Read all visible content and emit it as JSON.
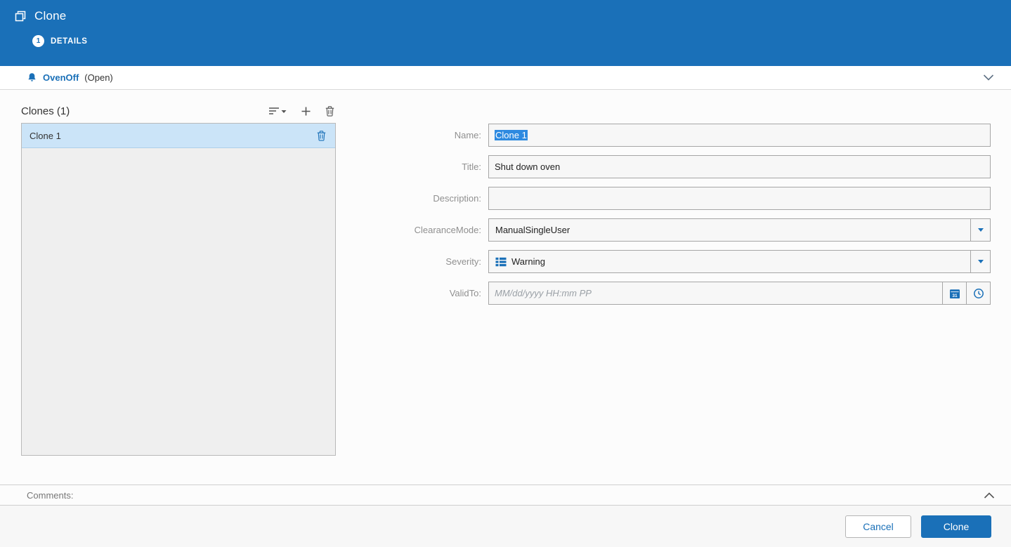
{
  "colors": {
    "accent": "#1a70b8",
    "selection": "#2e8ae0"
  },
  "header": {
    "title": "Clone",
    "step_number": "1",
    "step_label": "DETAILS"
  },
  "alarm_bar": {
    "name": "OvenOff",
    "status": "(Open)"
  },
  "clones_panel": {
    "title": "Clones (1)",
    "items": [
      {
        "label": "Clone 1",
        "selected": true
      }
    ]
  },
  "form": {
    "name": {
      "label": "Name:",
      "value": "Clone 1",
      "text_selected": true
    },
    "title": {
      "label": "Title:",
      "value": "Shut down oven"
    },
    "description": {
      "label": "Description:",
      "value": ""
    },
    "clearance_mode": {
      "label": "ClearanceMode:",
      "value": "ManualSingleUser"
    },
    "severity": {
      "label": "Severity:",
      "value": "Warning"
    },
    "valid_to": {
      "label": "ValidTo:",
      "value": "",
      "placeholder": "MM/dd/yyyy HH:mm PP"
    }
  },
  "comments": {
    "label": "Comments:"
  },
  "footer": {
    "cancel_label": "Cancel",
    "submit_label": "Clone"
  },
  "icons": {
    "clone": "copy-pages",
    "alarm": "bell",
    "sort_filter": "sort-lines-with-caret",
    "add": "plus",
    "delete": "trash-can",
    "severity": "list-grid",
    "calendar": "calendar-31",
    "time": "clock",
    "expand": "chevron-down",
    "collapse": "chevron-up"
  }
}
